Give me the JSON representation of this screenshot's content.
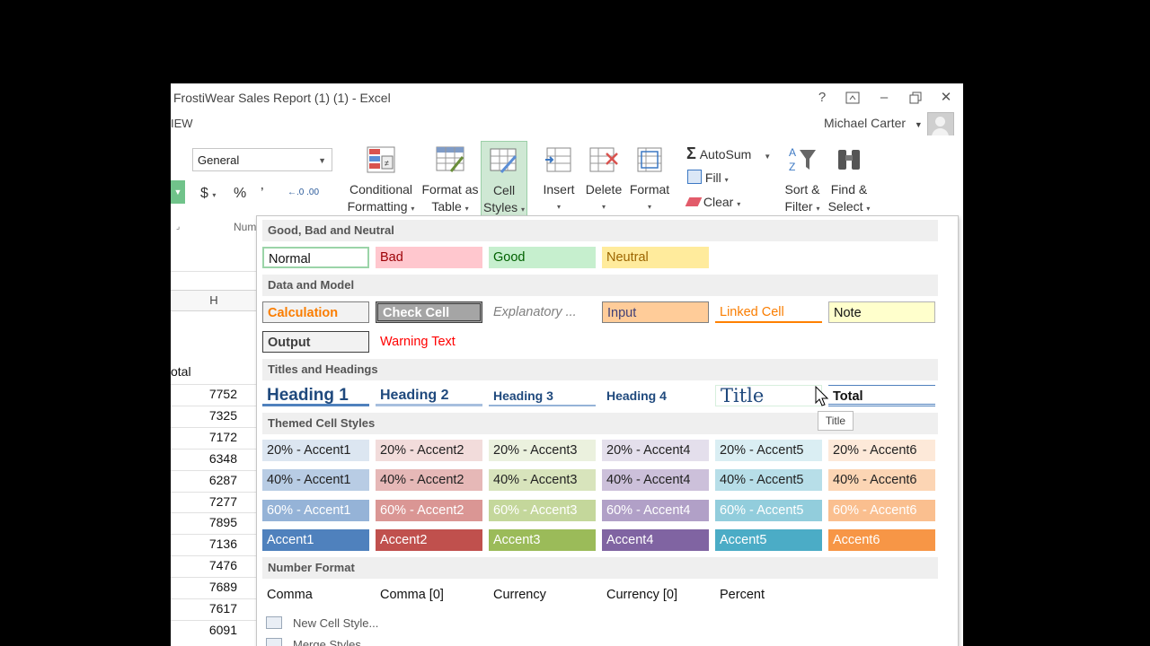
{
  "window": {
    "title": "FrostiWear Sales Report (1) (1) - Excel",
    "tab_fragment": "IEW",
    "user_name": "Michael Carter"
  },
  "ribbon": {
    "number_format_value": "General",
    "number_group_label": "Num",
    "currency_symbol": "$",
    "percent_symbol": "%",
    "comma_symbol": "’",
    "dec_symbol": "←.0 .00",
    "buttons": {
      "conditional_formatting": [
        "Conditional",
        "Formatting"
      ],
      "format_as_table": [
        "Format as",
        "Table"
      ],
      "cell_styles": [
        "Cell",
        "Styles"
      ],
      "insert": "Insert",
      "delete": "Delete",
      "format": "Format",
      "autosum": "AutoSum",
      "fill": "Fill",
      "clear": "Clear",
      "sort_filter": [
        "Sort &",
        "Filter"
      ],
      "find_select": [
        "Find &",
        "Select"
      ]
    }
  },
  "sheet": {
    "column_header": "H",
    "col_label": "otal",
    "values": [
      "7752",
      "7325",
      "7172",
      "6348",
      "6287",
      "7277",
      "7895",
      "7136",
      "7476",
      "7689",
      "7617",
      "6091"
    ]
  },
  "gallery": {
    "sections": {
      "good_bad": "Good, Bad and Neutral",
      "data_model": "Data and Model",
      "titles": "Titles and Headings",
      "themed": "Themed Cell Styles",
      "number_format": "Number Format"
    },
    "good_bad": [
      "Normal",
      "Bad",
      "Good",
      "Neutral"
    ],
    "data_model_row1": [
      "Calculation",
      "Check Cell",
      "Explanatory ...",
      "Input",
      "Linked Cell",
      "Note"
    ],
    "data_model_row2": [
      "Output",
      "Warning Text"
    ],
    "titles": [
      "Heading 1",
      "Heading 2",
      "Heading 3",
      "Heading 4",
      "Title",
      "Total"
    ],
    "themed_20": [
      "20% - Accent1",
      "20% - Accent2",
      "20% - Accent3",
      "20% - Accent4",
      "20% - Accent5",
      "20% - Accent6"
    ],
    "themed_40": [
      "40% - Accent1",
      "40% - Accent2",
      "40% - Accent3",
      "40% - Accent4",
      "40% - Accent5",
      "40% - Accent6"
    ],
    "themed_60": [
      "60% - Accent1",
      "60% - Accent2",
      "60% - Accent3",
      "60% - Accent4",
      "60% - Accent5",
      "60% - Accent6"
    ],
    "themed_100": [
      "Accent1",
      "Accent2",
      "Accent3",
      "Accent4",
      "Accent5",
      "Accent6"
    ],
    "number_formats": [
      "Comma",
      "Comma [0]",
      "Currency",
      "Currency [0]",
      "Percent"
    ],
    "tooltip": "Title",
    "new_cell_style": "New Cell Style...",
    "merge_styles": "Merge Styles..."
  },
  "colors": {
    "accent_green": "#217346",
    "accent1": "#4f81bd",
    "accent2": "#c0504d",
    "accent3": "#9bbb59",
    "accent4": "#8064a2",
    "accent5": "#4bacc6",
    "accent6": "#f79646"
  }
}
